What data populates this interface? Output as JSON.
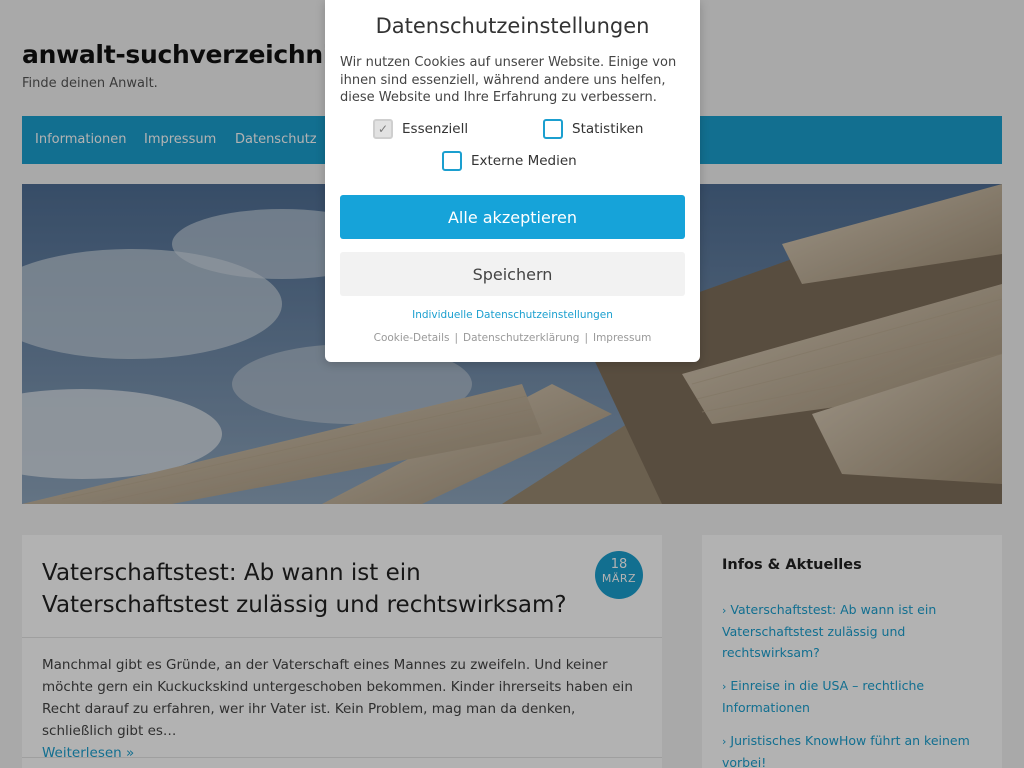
{
  "site": {
    "title": "anwalt-suchverzeichnis.de",
    "tagline": "Finde deinen Anwalt."
  },
  "nav": {
    "items": [
      {
        "label": "Informationen"
      },
      {
        "label": "Impressum"
      },
      {
        "label": "Datenschutz"
      }
    ]
  },
  "article": {
    "title": "Vaterschaftstest: Ab wann ist ein Vaterschaftstest zulässig und rechtswirksam?",
    "date_day": "18",
    "date_month": "MÄRZ",
    "excerpt": "Manchmal gibt es Gründe, an der Vaterschaft eines Mannes zu zweifeln. Und keiner möchte gern ein Kuckuckskind untergeschoben bekommen. Kinder ihrerseits haben ein Recht darauf zu erfahren, wer ihr Vater ist. Kein Problem, mag man da denken, schließlich gibt es…",
    "read_more": "Weiterlesen »"
  },
  "sidebar": {
    "title": "Infos & Aktuelles",
    "links": [
      {
        "label": "Vaterschaftstest: Ab wann ist ein Vaterschaftstest zulässig und rechtswirksam?"
      },
      {
        "label": "Einreise in die USA – rechtliche Informationen"
      },
      {
        "label": "Juristisches KnowHow führt an keinem vorbei!"
      }
    ]
  },
  "cookie_modal": {
    "title": "Datenschutzeinstellungen",
    "text": "Wir nutzen Cookies auf unserer Website. Einige von ihnen sind essenziell, während andere uns helfen, diese Website und Ihre Erfahrung zu verbessern.",
    "options": [
      {
        "label": "Essenziell",
        "checked": true
      },
      {
        "label": "Statistiken",
        "checked": false
      },
      {
        "label": "Externe Medien",
        "checked": false
      }
    ],
    "accept_all": "Alle akzeptieren",
    "save": "Speichern",
    "individual": "Individuelle Datenschutzeinstellungen",
    "footer": {
      "cookie_details": "Cookie-Details",
      "privacy": "Datenschutzerklärung",
      "imprint": "Impressum",
      "separator": "|"
    }
  },
  "colors": {
    "accent": "#1b9fcf",
    "button_primary": "#16a3d9"
  }
}
